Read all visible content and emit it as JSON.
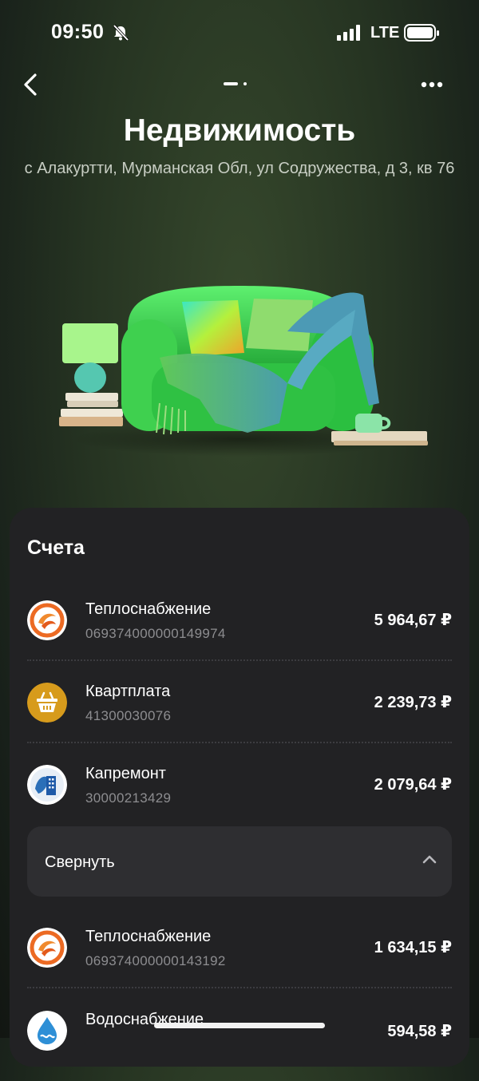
{
  "status_bar": {
    "time": "09:50",
    "network": "LTE"
  },
  "header": {
    "title": "Недвижимость",
    "address": "с Алакуртти, Мурманская Обл, ул Содружества, д 3, кв 76"
  },
  "accounts": {
    "title": "Счета",
    "items": [
      {
        "name": "Теплоснабжение",
        "number": "069374000000149974",
        "amount": "5 964,67 ₽",
        "icon": "heat-supply-logo"
      },
      {
        "name": "Квартплата",
        "number": "41300030076",
        "amount": "2 239,73 ₽",
        "icon": "basket-logo"
      },
      {
        "name": "Капремонт",
        "number": "30000213429",
        "amount": "2 079,64 ₽",
        "icon": "building-logo"
      }
    ],
    "collapse_label": "Свернуть",
    "extra_items": [
      {
        "name": "Теплоснабжение",
        "number": "069374000000143192",
        "amount": "1 634,15 ₽",
        "icon": "heat-supply-logo"
      },
      {
        "name": "Водоснабжение",
        "number": "",
        "amount": "594,58 ₽",
        "icon": "water-drop-logo"
      }
    ]
  }
}
